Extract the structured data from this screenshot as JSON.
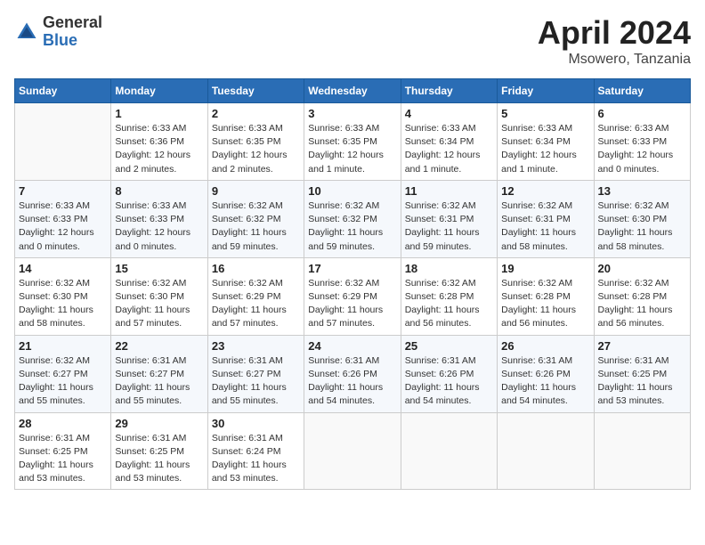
{
  "header": {
    "logo_general": "General",
    "logo_blue": "Blue",
    "month_year": "April 2024",
    "location": "Msowero, Tanzania"
  },
  "days_of_week": [
    "Sunday",
    "Monday",
    "Tuesday",
    "Wednesday",
    "Thursday",
    "Friday",
    "Saturday"
  ],
  "weeks": [
    [
      {
        "day": "",
        "sunrise": "",
        "sunset": "",
        "daylight": "",
        "empty": true
      },
      {
        "day": "1",
        "sunrise": "6:33 AM",
        "sunset": "6:36 PM",
        "daylight": "12 hours and 2 minutes."
      },
      {
        "day": "2",
        "sunrise": "6:33 AM",
        "sunset": "6:35 PM",
        "daylight": "12 hours and 2 minutes."
      },
      {
        "day": "3",
        "sunrise": "6:33 AM",
        "sunset": "6:35 PM",
        "daylight": "12 hours and 1 minute."
      },
      {
        "day": "4",
        "sunrise": "6:33 AM",
        "sunset": "6:34 PM",
        "daylight": "12 hours and 1 minute."
      },
      {
        "day": "5",
        "sunrise": "6:33 AM",
        "sunset": "6:34 PM",
        "daylight": "12 hours and 1 minute."
      },
      {
        "day": "6",
        "sunrise": "6:33 AM",
        "sunset": "6:33 PM",
        "daylight": "12 hours and 0 minutes."
      }
    ],
    [
      {
        "day": "7",
        "sunrise": "6:33 AM",
        "sunset": "6:33 PM",
        "daylight": "12 hours and 0 minutes."
      },
      {
        "day": "8",
        "sunrise": "6:33 AM",
        "sunset": "6:33 PM",
        "daylight": "12 hours and 0 minutes."
      },
      {
        "day": "9",
        "sunrise": "6:32 AM",
        "sunset": "6:32 PM",
        "daylight": "11 hours and 59 minutes."
      },
      {
        "day": "10",
        "sunrise": "6:32 AM",
        "sunset": "6:32 PM",
        "daylight": "11 hours and 59 minutes."
      },
      {
        "day": "11",
        "sunrise": "6:32 AM",
        "sunset": "6:31 PM",
        "daylight": "11 hours and 59 minutes."
      },
      {
        "day": "12",
        "sunrise": "6:32 AM",
        "sunset": "6:31 PM",
        "daylight": "11 hours and 58 minutes."
      },
      {
        "day": "13",
        "sunrise": "6:32 AM",
        "sunset": "6:30 PM",
        "daylight": "11 hours and 58 minutes."
      }
    ],
    [
      {
        "day": "14",
        "sunrise": "6:32 AM",
        "sunset": "6:30 PM",
        "daylight": "11 hours and 58 minutes."
      },
      {
        "day": "15",
        "sunrise": "6:32 AM",
        "sunset": "6:30 PM",
        "daylight": "11 hours and 57 minutes."
      },
      {
        "day": "16",
        "sunrise": "6:32 AM",
        "sunset": "6:29 PM",
        "daylight": "11 hours and 57 minutes."
      },
      {
        "day": "17",
        "sunrise": "6:32 AM",
        "sunset": "6:29 PM",
        "daylight": "11 hours and 57 minutes."
      },
      {
        "day": "18",
        "sunrise": "6:32 AM",
        "sunset": "6:28 PM",
        "daylight": "11 hours and 56 minutes."
      },
      {
        "day": "19",
        "sunrise": "6:32 AM",
        "sunset": "6:28 PM",
        "daylight": "11 hours and 56 minutes."
      },
      {
        "day": "20",
        "sunrise": "6:32 AM",
        "sunset": "6:28 PM",
        "daylight": "11 hours and 56 minutes."
      }
    ],
    [
      {
        "day": "21",
        "sunrise": "6:32 AM",
        "sunset": "6:27 PM",
        "daylight": "11 hours and 55 minutes."
      },
      {
        "day": "22",
        "sunrise": "6:31 AM",
        "sunset": "6:27 PM",
        "daylight": "11 hours and 55 minutes."
      },
      {
        "day": "23",
        "sunrise": "6:31 AM",
        "sunset": "6:27 PM",
        "daylight": "11 hours and 55 minutes."
      },
      {
        "day": "24",
        "sunrise": "6:31 AM",
        "sunset": "6:26 PM",
        "daylight": "11 hours and 54 minutes."
      },
      {
        "day": "25",
        "sunrise": "6:31 AM",
        "sunset": "6:26 PM",
        "daylight": "11 hours and 54 minutes."
      },
      {
        "day": "26",
        "sunrise": "6:31 AM",
        "sunset": "6:26 PM",
        "daylight": "11 hours and 54 minutes."
      },
      {
        "day": "27",
        "sunrise": "6:31 AM",
        "sunset": "6:25 PM",
        "daylight": "11 hours and 53 minutes."
      }
    ],
    [
      {
        "day": "28",
        "sunrise": "6:31 AM",
        "sunset": "6:25 PM",
        "daylight": "11 hours and 53 minutes."
      },
      {
        "day": "29",
        "sunrise": "6:31 AM",
        "sunset": "6:25 PM",
        "daylight": "11 hours and 53 minutes."
      },
      {
        "day": "30",
        "sunrise": "6:31 AM",
        "sunset": "6:24 PM",
        "daylight": "11 hours and 53 minutes."
      },
      {
        "day": "",
        "sunrise": "",
        "sunset": "",
        "daylight": "",
        "empty": true
      },
      {
        "day": "",
        "sunrise": "",
        "sunset": "",
        "daylight": "",
        "empty": true
      },
      {
        "day": "",
        "sunrise": "",
        "sunset": "",
        "daylight": "",
        "empty": true
      },
      {
        "day": "",
        "sunrise": "",
        "sunset": "",
        "daylight": "",
        "empty": true
      }
    ]
  ]
}
